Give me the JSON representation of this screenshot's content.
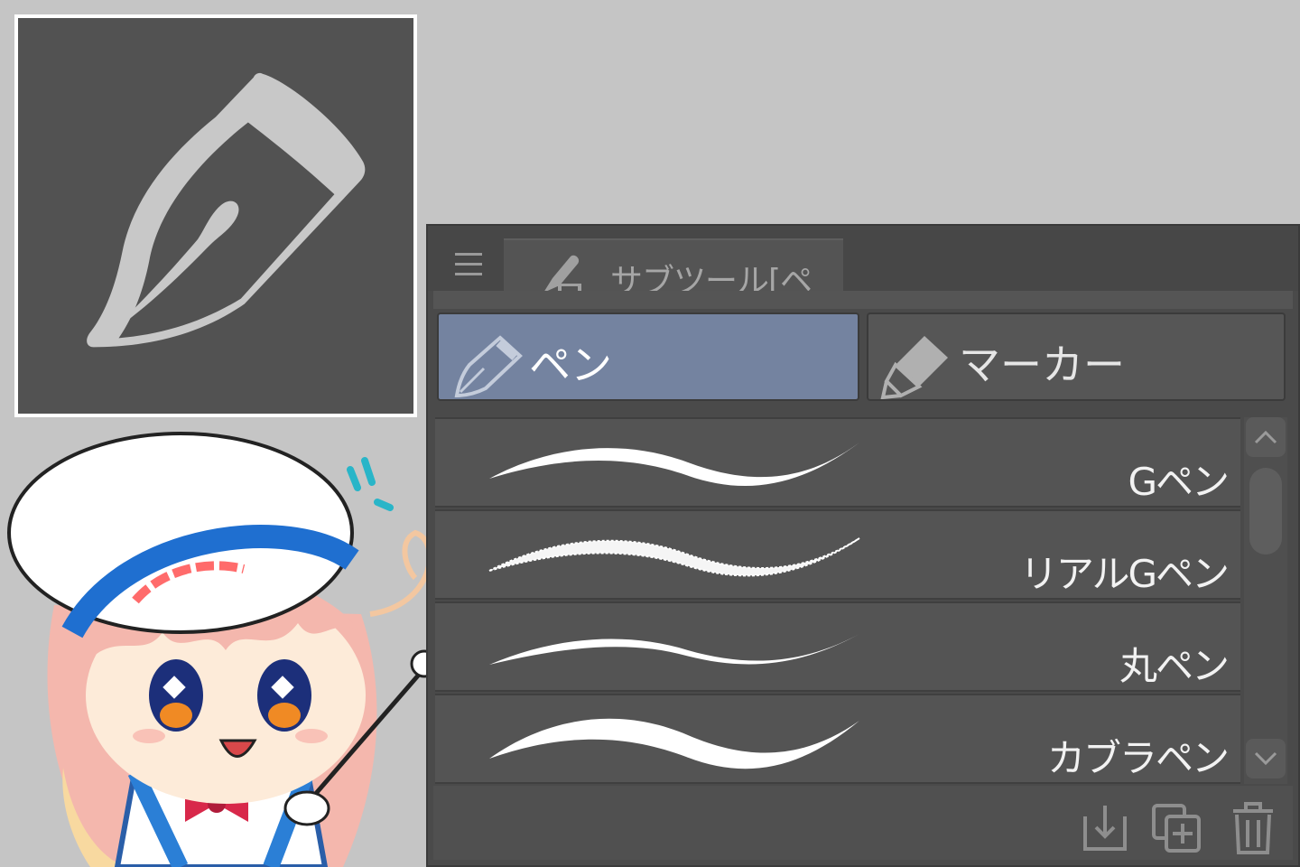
{
  "panel": {
    "tab_title": "サブツール[ペン]",
    "groups": [
      {
        "label": "ペン",
        "active": true,
        "icon": "pen-nib-icon"
      },
      {
        "label": "マーカー",
        "active": false,
        "icon": "marker-icon"
      }
    ],
    "brushes": [
      {
        "label": "Gペン"
      },
      {
        "label": "リアルGペン"
      },
      {
        "label": "丸ペン"
      },
      {
        "label": "カブラペン"
      }
    ],
    "actions": [
      "import-icon",
      "duplicate-icon",
      "trash-icon"
    ]
  },
  "colors": {
    "background": "#c5c5c5",
    "panel": "#4a4a4a",
    "active_group": "#7483a0",
    "icon_card": "#525252"
  }
}
